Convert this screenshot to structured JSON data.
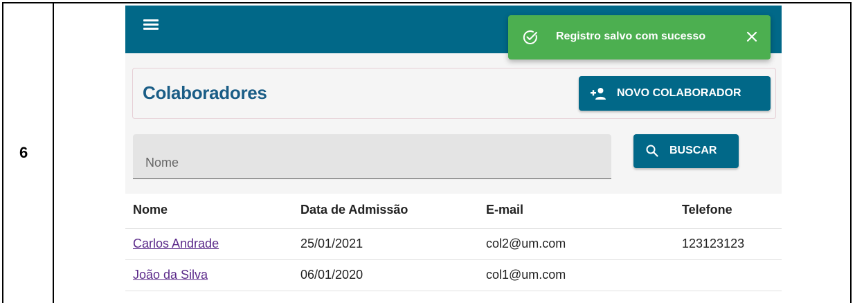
{
  "row_number": "6",
  "toast": {
    "message": "Registro salvo com sucesso",
    "icon": "check-circle-icon",
    "close_icon": "close-icon",
    "color": "#4caf50"
  },
  "topbar": {
    "menu_icon": "menu-icon",
    "color": "#016888"
  },
  "header": {
    "title": "Colaboradores",
    "new_button_label": "NOVO COLABORADOR",
    "new_button_icon": "add-person-icon"
  },
  "search": {
    "placeholder": "Nome",
    "value": "",
    "button_label": "BUSCAR",
    "button_icon": "search-icon"
  },
  "table": {
    "columns": [
      "Nome",
      "Data de Admissão",
      "E-mail",
      "Telefone"
    ],
    "rows": [
      {
        "nome": "Carlos Andrade",
        "data": "25/01/2021",
        "email": "col2@um.com",
        "telefone": "123123123"
      },
      {
        "nome": "João da Silva",
        "data": "06/01/2020",
        "email": "col1@um.com",
        "telefone": ""
      }
    ]
  }
}
